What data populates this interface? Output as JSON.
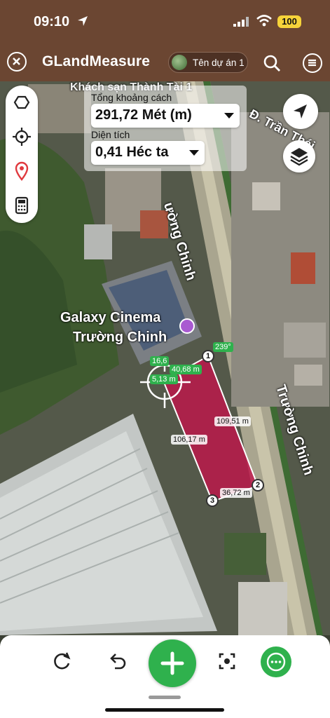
{
  "status_bar": {
    "time": "09:10",
    "battery": "100"
  },
  "app_bar": {
    "title": "GLandMeasure",
    "project_label": "Tên dự án 1"
  },
  "measurement": {
    "distance_label": "Tổng khoảng cách",
    "distance_value": "291,72 Mét (m)",
    "area_label": "Diện tích",
    "area_value": "0,41 Héc ta"
  },
  "map": {
    "poi_name_line1": "Galaxy Cinema",
    "poi_name_line2": "Trường Chinh",
    "road_label_main": "Trường Chinh",
    "road_label_upper": "ường Chinh",
    "road_label_top_right": "Đ. Trần Thái",
    "top_label": "Khách sạn Thành Tài 1",
    "angle_label": "239°",
    "small_label": "16,6",
    "segments": [
      "40,68 m",
      "5,13 m",
      "109,51 m",
      "106,17 m",
      "36,72 m"
    ],
    "vertices": [
      "1",
      "2",
      "3"
    ]
  },
  "colors": {
    "accent": "#2fb14d",
    "bar": "#6b4632",
    "polygon": "#c0144a"
  }
}
